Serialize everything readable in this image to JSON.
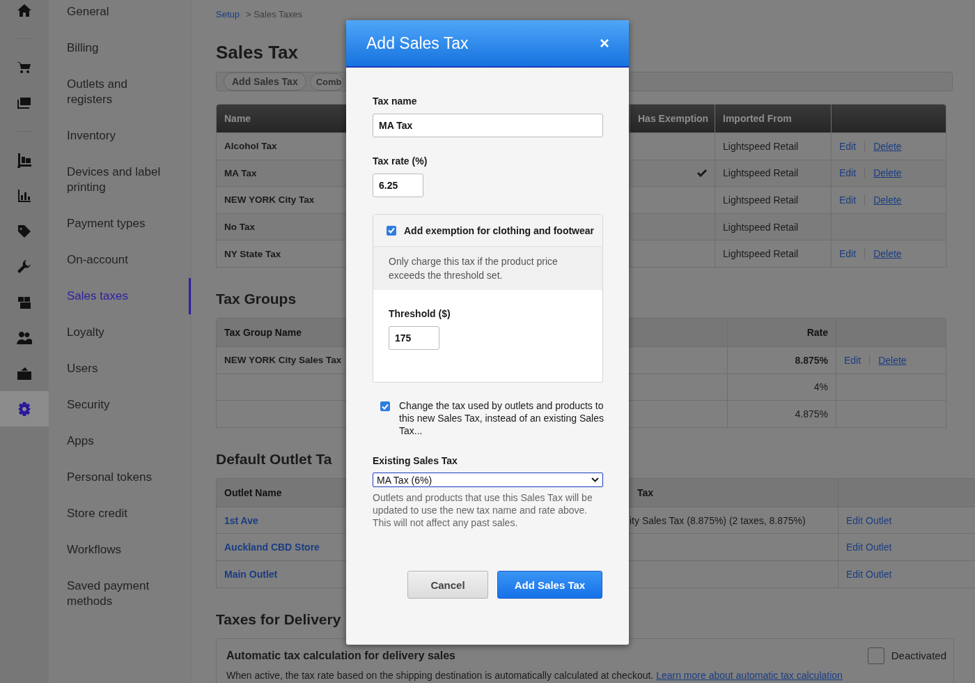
{
  "rail": [
    {
      "selected": false
    },
    {
      "selected": false
    },
    {
      "selected": false
    },
    {
      "selected": false
    },
    {
      "selected": false
    },
    {
      "selected": false
    },
    {
      "selected": false
    },
    {
      "selected": false
    },
    {
      "selected": false
    },
    {
      "selected": false
    },
    {
      "selected": true
    }
  ],
  "nav": [
    {
      "label": "General",
      "selected": false
    },
    {
      "label": "Billing",
      "selected": false
    },
    {
      "label": "Outlets and registers",
      "selected": false
    },
    {
      "label": "Inventory",
      "selected": false
    },
    {
      "label": "Devices and label printing",
      "selected": false
    },
    {
      "label": "Payment types",
      "selected": false
    },
    {
      "label": "On-account",
      "selected": false
    },
    {
      "label": "Sales taxes",
      "selected": true
    },
    {
      "label": "Loyalty",
      "selected": false
    },
    {
      "label": "Users",
      "selected": false
    },
    {
      "label": "Security",
      "selected": false
    },
    {
      "label": "Apps",
      "selected": false
    },
    {
      "label": "Personal tokens",
      "selected": false
    },
    {
      "label": "Store credit",
      "selected": false
    },
    {
      "label": "Workflows",
      "selected": false
    },
    {
      "label": "Saved payment methods",
      "selected": false
    }
  ],
  "breadcrumb": {
    "link": "Setup",
    "current": "> Sales Taxes"
  },
  "page_title": "Sales Tax",
  "toolbar_buttons": [
    "Add Sales Tax",
    "Comb"
  ],
  "sales_tax_table": {
    "columns": [
      "Name",
      "Has Exemption",
      "Imported From"
    ],
    "rows": [
      {
        "name": "Alcohol Tax",
        "has_exemption": false,
        "imported_from": "Lightspeed Retail",
        "actions": [
          "Edit",
          "Delete"
        ]
      },
      {
        "name": "MA Tax",
        "has_exemption": true,
        "imported_from": "Lightspeed Retail",
        "actions": [
          "Edit",
          "Delete"
        ]
      },
      {
        "name": "NEW YORK City Tax",
        "has_exemption": false,
        "imported_from": "Lightspeed Retail",
        "actions": [
          "Edit",
          "Delete"
        ]
      },
      {
        "name": "No Tax",
        "has_exemption": false,
        "imported_from": "Lightspeed Retail",
        "actions": []
      },
      {
        "name": "NY State Tax",
        "has_exemption": false,
        "imported_from": "Lightspeed Retail",
        "actions": [
          "Edit",
          "Delete"
        ]
      }
    ]
  },
  "tax_groups": {
    "heading": "Tax Groups",
    "columns": [
      "Tax Group Name",
      "Rate"
    ],
    "rows": [
      {
        "kind": "group",
        "name": "NEW YORK City Sales Tax",
        "rate": "8.875%",
        "actions": [
          "Edit",
          "Delete"
        ]
      },
      {
        "kind": "member",
        "rate": "4%",
        "actions": []
      },
      {
        "kind": "member",
        "rate": "4.875%",
        "actions": []
      }
    ]
  },
  "default_outlet_tax": {
    "heading": "Default Outlet Ta",
    "columns": [
      "Outlet Name",
      "Tax"
    ],
    "rows": [
      {
        "outlet": "1st Ave",
        "tax": "ity Sales Tax (8.875%) (2 taxes, 8.875%)",
        "action": "Edit Outlet"
      },
      {
        "outlet": "Auckland CBD Store",
        "action": "Edit Outlet"
      },
      {
        "outlet": "Main Outlet",
        "action": "Edit Outlet"
      }
    ]
  },
  "delivery": {
    "heading": "Taxes for Delivery",
    "title": "Automatic tax calculation for delivery sales",
    "toggle": {
      "label": "Deactivated",
      "checked": false
    },
    "description": "When active, the tax rate based on the shipping destination is automatically calculated at checkout.",
    "link": "Learn more about automatic tax calculation"
  },
  "modal": {
    "title": "Add Sales Tax",
    "tax_name": {
      "label": "Tax name",
      "value": "MA Tax"
    },
    "tax_rate": {
      "label": "Tax rate (%)",
      "value": "6.25"
    },
    "exemption": {
      "label": "Add exemption for clothing and footwear",
      "checked": true,
      "description": "Only charge this tax if the product price exceeds the threshold set.",
      "threshold": {
        "label": "Threshold ($)",
        "value": "175"
      }
    },
    "replace_existing": {
      "label": "Change the tax used by outlets and products to this new Sales Tax, instead of an existing Sales Tax...",
      "checked": true
    },
    "existing_tax": {
      "label": "Existing Sales Tax",
      "value": "MA Tax (6%)",
      "help": "Outlets and products that use this Sales Tax will be updated to use the new tax name and rate above. This will not affect any past sales."
    },
    "buttons": [
      {
        "label": "Cancel",
        "kind": "secondary"
      },
      {
        "label": "Add Sales Tax",
        "kind": "primary"
      }
    ]
  }
}
